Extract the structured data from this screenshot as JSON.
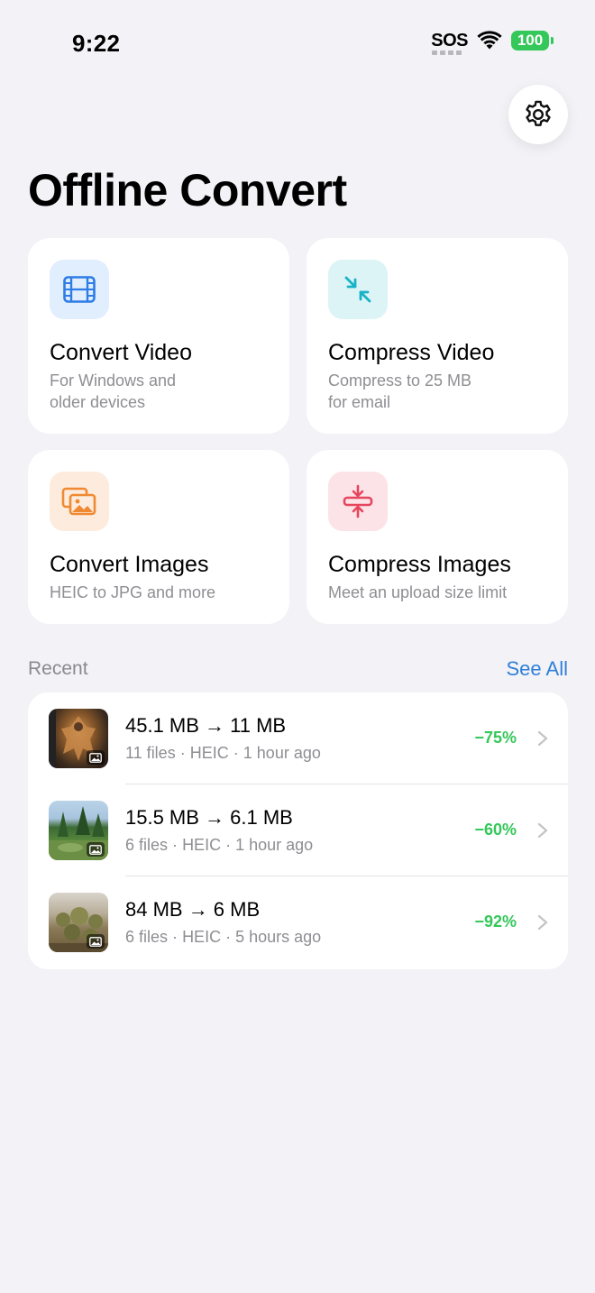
{
  "status_bar": {
    "time": "9:22",
    "sos": "SOS",
    "battery": "100"
  },
  "header": {
    "title": "Offline Convert"
  },
  "cards": [
    {
      "title": "Convert Video",
      "desc1": "For Windows and",
      "desc2": "older devices",
      "icon": "film-icon",
      "tint": "#E1EEFD",
      "accent": "#2E7CE6"
    },
    {
      "title": "Compress Video",
      "desc1": "Compress to 25 MB",
      "desc2": "for email",
      "icon": "compress-arrows-icon",
      "tint": "#DDF4F7",
      "accent": "#17B3C6"
    },
    {
      "title": "Convert Images",
      "desc1": "HEIC to JPG and more",
      "desc2": "",
      "icon": "photos-icon",
      "tint": "#FDEBDD",
      "accent": "#F08A32"
    },
    {
      "title": "Compress Images",
      "desc1": "Meet an upload size limit",
      "desc2": "",
      "icon": "compress-vertical-icon",
      "tint": "#FCE3E7",
      "accent": "#E6455E"
    }
  ],
  "recent": {
    "title": "Recent",
    "see_all": "See All",
    "items": [
      {
        "size": "45.1 MB → 11 MB",
        "files": "11 files",
        "format": "HEIC",
        "time": "1 hour ago",
        "reduction": "−75%"
      },
      {
        "size": "15.5 MB → 6.1 MB",
        "files": "6 files",
        "format": "HEIC",
        "time": "1 hour ago",
        "reduction": "−60%"
      },
      {
        "size": "84 MB → 6 MB",
        "files": "6 files",
        "format": "HEIC",
        "time": "5 hours ago",
        "reduction": "−92%"
      }
    ],
    "separator": "·"
  },
  "colors": {
    "background": "#F2F2F7",
    "accent_blue": "#2F7FD8",
    "success_green": "#34C759"
  }
}
